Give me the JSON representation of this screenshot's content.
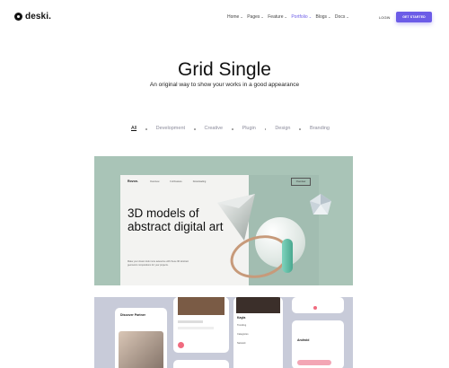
{
  "header": {
    "logo_text": "deski.",
    "nav": [
      {
        "label": "Home",
        "active": false
      },
      {
        "label": "Pages",
        "active": false
      },
      {
        "label": "Feature",
        "active": false
      },
      {
        "label": "Portfolio",
        "active": true
      },
      {
        "label": "Blogs",
        "active": false
      },
      {
        "label": "Docs",
        "active": false
      }
    ],
    "login_label": "LOGIN",
    "cta_label": "GET STARTED",
    "accent_color": "#6c5ce7"
  },
  "hero": {
    "title": "Grid Single",
    "subtitle": "An original way to show your works in a good appearance"
  },
  "filters": {
    "items": [
      "All",
      "Development",
      "Creative",
      "Plugin",
      "Design",
      "Branding"
    ],
    "active": "All"
  },
  "portfolio": {
    "card1": {
      "logo": "Rovon.",
      "nav": [
        "Overview",
        "Full Feature",
        "Downloading"
      ],
      "button": "Overview",
      "headline": "3D models of abstract digital art",
      "description": "Make your dream look more awesome with these 3D abstract geometric compositions for your projects."
    },
    "card2": {
      "phone1_title": "Discover Partner",
      "phone3_name": "Kayla",
      "phone3_items": [
        "Trending",
        "Categories",
        "Network"
      ],
      "phone4_name": "Android"
    }
  }
}
